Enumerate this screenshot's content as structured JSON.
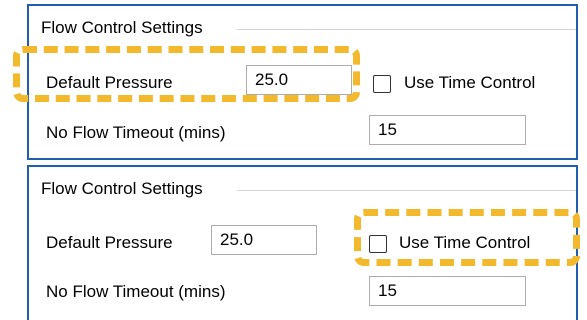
{
  "panels": [
    {
      "group_title": "Flow Control Settings",
      "default_pressure": {
        "label": "Default Pressure",
        "value": "25.0"
      },
      "use_time_control": {
        "label": "Use Time Control",
        "checked": false
      },
      "no_flow_timeout": {
        "label": "No Flow Timeout (mins)",
        "value": "15"
      },
      "highlighted": "default-pressure"
    },
    {
      "group_title": "Flow Control Settings",
      "default_pressure": {
        "label": "Default Pressure",
        "value": "25.0"
      },
      "use_time_control": {
        "label": "Use Time Control",
        "checked": false
      },
      "no_flow_timeout": {
        "label": "No Flow Timeout (mins)",
        "value": "15"
      },
      "highlighted": "use-time-control"
    }
  ],
  "colors": {
    "panel_border": "#1f5fae",
    "highlight": "#f2b92d",
    "input_border": "#adadad"
  }
}
